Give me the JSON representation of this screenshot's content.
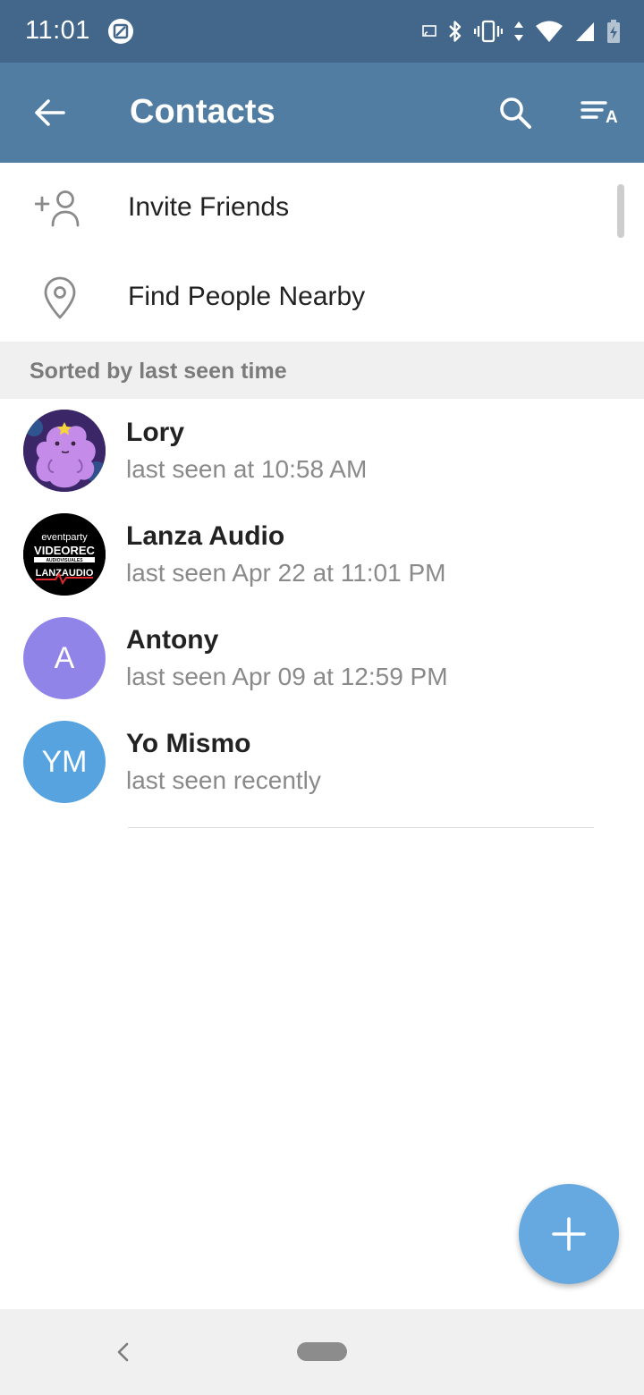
{
  "status_bar": {
    "time": "11:01",
    "icons": [
      "screenshot-icon",
      "cast-icon",
      "bluetooth-icon",
      "vibrate-icon",
      "data-arrows-icon",
      "wifi-icon",
      "signal-icon",
      "battery-charging-icon"
    ]
  },
  "app_bar": {
    "title": "Contacts",
    "back_icon": "arrow-left-icon",
    "search_icon": "search-icon",
    "sort_icon": "sort-alpha-icon",
    "sort_letter": "A",
    "background": "#517da2"
  },
  "actions": [
    {
      "label": "Invite Friends",
      "icon": "add-person-icon"
    },
    {
      "label": "Find People Nearby",
      "icon": "location-pin-icon"
    }
  ],
  "section_header": "Sorted by last seen time",
  "contacts": [
    {
      "name": "Lory",
      "status": "last seen at 10:58 AM",
      "avatar_type": "image"
    },
    {
      "name": "Lanza Audio",
      "status": "last seen Apr 22 at 11:01 PM",
      "avatar_type": "image",
      "avatar_logo": {
        "line1": "eventparty",
        "line2": "VIDEOREC",
        "line3": "AUDIOVISUALES",
        "line4": "LANZAUDIO"
      }
    },
    {
      "name": "Antony",
      "status": "last seen Apr 09 at 12:59 PM",
      "avatar_type": "initials",
      "initials": "A",
      "color": "#9184e8"
    },
    {
      "name": "Yo Mismo",
      "status": "last seen recently",
      "avatar_type": "initials",
      "initials": "YM",
      "color": "#56a3e0"
    }
  ],
  "fab": {
    "icon": "plus-icon",
    "color": "#65a9e0"
  },
  "nav_bar": {
    "back_icon": "nav-back-icon",
    "home_icon": "home-pill-icon"
  }
}
